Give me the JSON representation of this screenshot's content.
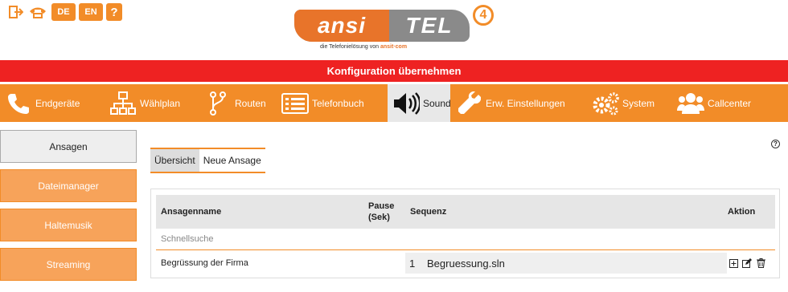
{
  "top_icons": {
    "logout_icon": "logout-icon",
    "phone_icon": "phone-icon",
    "lang_de": "DE",
    "lang_en": "EN",
    "help_label": "?"
  },
  "logo": {
    "part1": "ansi",
    "part2": "TEL",
    "version": "4",
    "tagline_prefix": "die Telefonielösung von",
    "tagline_brand": "ansit·com"
  },
  "apply_bar": {
    "label": "Konfiguration übernehmen"
  },
  "nav": [
    {
      "label": "Endgeräte",
      "icon": "phone-handset-icon"
    },
    {
      "label": "Wählplan",
      "icon": "sitemap-icon"
    },
    {
      "label": "Routen",
      "icon": "route-icon"
    },
    {
      "label": "Telefonbuch",
      "icon": "list-icon"
    },
    {
      "label": "Sound",
      "icon": "speaker-icon"
    },
    {
      "label": "Erw. Einstellungen",
      "icon": "wrench-icon"
    },
    {
      "label": "System",
      "icon": "gears-icon"
    },
    {
      "label": "Callcenter",
      "icon": "users-icon"
    }
  ],
  "sidebar": [
    {
      "label": "Ansagen"
    },
    {
      "label": "Dateimanager"
    },
    {
      "label": "Haltemusik"
    },
    {
      "label": "Streaming"
    }
  ],
  "tabs": [
    {
      "label": "Übersicht"
    },
    {
      "label": "Neue Ansage"
    }
  ],
  "help": "?",
  "table": {
    "headers": {
      "name": "Ansagenname",
      "pause_line1": "Pause",
      "pause_line2": "(Sek)",
      "sequence": "Sequenz",
      "action": "Aktion"
    },
    "filter_placeholder": "Schnellsuche",
    "rows": [
      {
        "name": "Begrüssung der Firma",
        "pause": "",
        "seq_index": "1",
        "seq_file": "Begruessung.sln"
      }
    ]
  },
  "colors": {
    "orange": "#f28c28",
    "red": "#ee2222",
    "gray": "#8a8a8a"
  }
}
